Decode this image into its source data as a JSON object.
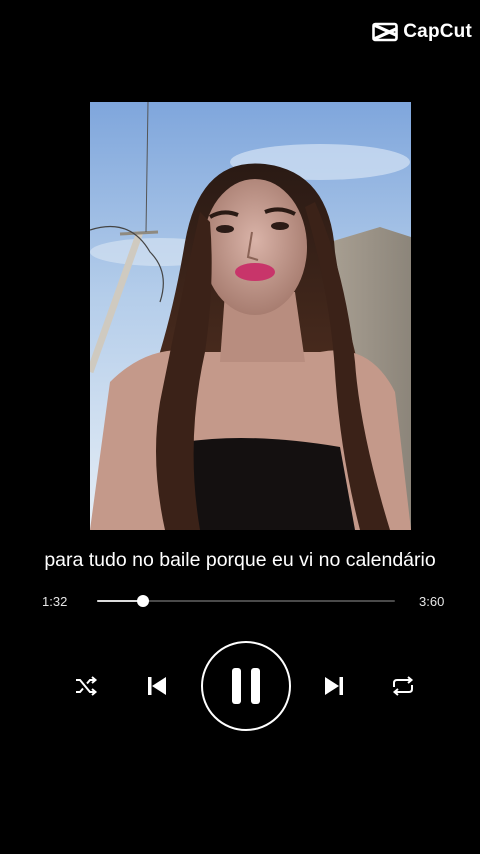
{
  "watermark": {
    "label": "CapCut",
    "icon": "capcut-logo-icon"
  },
  "lyric": "para tudo no baile porque eu vi no calendário",
  "player": {
    "current_time": "1:32",
    "total_time": "3:60",
    "progress": 0.155
  },
  "controls": [
    "shuffle-icon",
    "previous-icon",
    "pause-icon",
    "next-icon",
    "repeat-icon"
  ],
  "colors": {
    "background": "#000000",
    "foreground": "#ffffff",
    "track": "#4a4a4a"
  }
}
